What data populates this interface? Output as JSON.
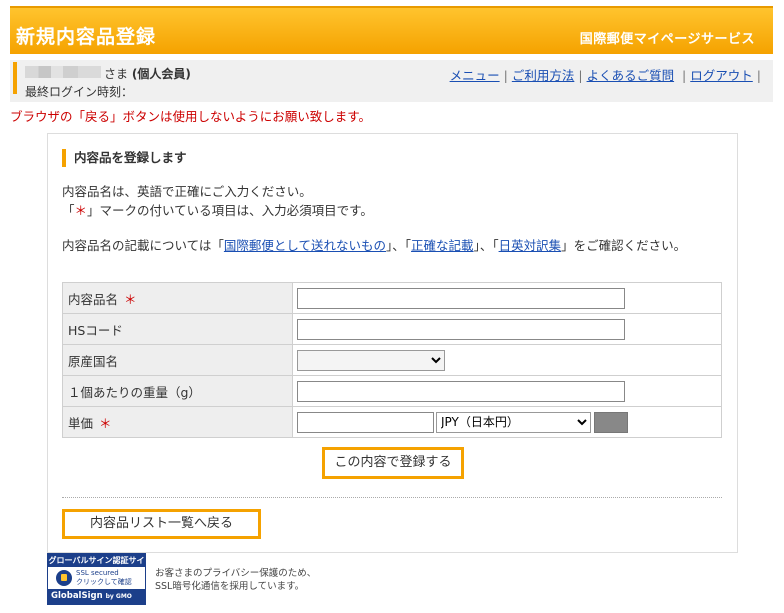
{
  "header": {
    "title": "新規内容品登録",
    "service": "国際郵便マイページサービス"
  },
  "user": {
    "honorific": "さま",
    "member_type": "(個人会員)",
    "last_login_label": "最終ログイン時刻："
  },
  "nav": {
    "menu": "メニュー",
    "usage": "ご利用方法",
    "faq": "よくあるご質問",
    "logout": "ログアウト"
  },
  "warning": "ブラウザの「戻る」ボタンは使用しないようにお願い致します。",
  "section": {
    "title": "内容品を登録します",
    "line1": "内容品名は、英語で正確にご入力ください。",
    "line2_open": "「",
    "line2_mark": "＊",
    "line2_rest": "」マークの付いている項目は、入力必須項目です。",
    "para_start": "内容品名の記載については「",
    "link1": "国際郵便として送れないもの",
    "para_mid1": "」、「",
    "link2": "正確な記載",
    "para_mid2": "」、「",
    "link3": "日英対訳集",
    "para_end": "」をご確認ください。"
  },
  "form": {
    "name_label": "内容品名",
    "hs_label": "HSコード",
    "origin_label": "原産国名",
    "weight_label": "１個あたりの重量（g）",
    "price_label": "単価",
    "required_mark": "＊",
    "currency_selected": "JPY（日本円）",
    "origin_selected": ""
  },
  "buttons": {
    "register": "この内容で登録する",
    "back": "内容品リスト一覧へ戻る"
  },
  "seal": {
    "top": "グローバルサイン認証サイト",
    "ssl_line1": "SSL secured",
    "ssl_line2": "クリックして確認",
    "brand": "GlobalSign",
    "brand_sub": "by GMO"
  },
  "privacy": {
    "line1": "お客さまのプライバシー保護のため、",
    "line2": "SSL暗号化通信を採用しています。"
  },
  "colors": {
    "accent": "#f5a200",
    "link": "#1a4fb3",
    "warning": "#cc0000"
  }
}
